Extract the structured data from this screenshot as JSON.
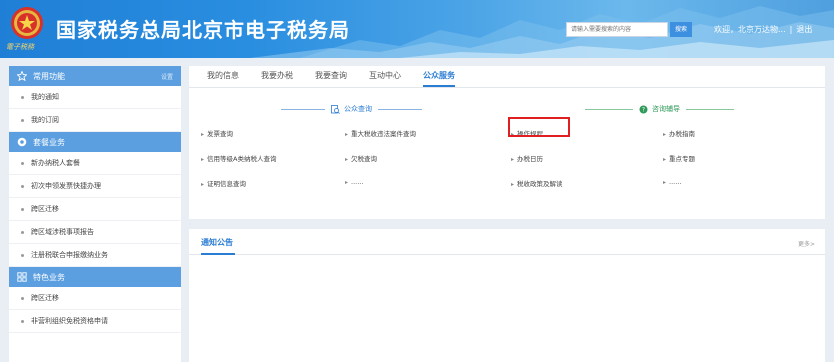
{
  "header": {
    "emblem_text": "電子税務",
    "site_title": "国家税务总局北京市电子税务局",
    "search_placeholder": "请输入需要搜索的内容",
    "search_button": "搜索",
    "welcome": "欢迎，北京万达物...",
    "logout": "退出"
  },
  "sidebar": {
    "section1": {
      "title": "常用功能",
      "extra": "设置",
      "icon": "star-icon"
    },
    "section1_items": [
      "我的通知",
      "我的订阅"
    ],
    "section2": {
      "title": "套餐业务",
      "icon": "package-icon"
    },
    "section2_items": [
      "新办纳税人套餐",
      "初次申领发票快捷办理",
      "跨区迁移",
      "跨区域涉税事项报告",
      "注册税联合申报缴纳业务"
    ],
    "section3": {
      "title": "特色业务",
      "icon": "grid-icon"
    },
    "section3_items": [
      "跨区迁移",
      "非营利组织免税资格申请"
    ]
  },
  "tabs": [
    "我的信息",
    "我要办税",
    "我要查询",
    "互动中心",
    "公众服务"
  ],
  "active_tab": "公众服务",
  "public_query": {
    "title": "公众查询",
    "items": [
      "发票查询",
      "重大税收违法案件查询",
      "信用等级A类纳税人查询",
      "欠税查询",
      "证明信息查询",
      "......"
    ]
  },
  "consult": {
    "title": "咨询辅导",
    "items": [
      "操作规程",
      "办税指南",
      "办税日历",
      "重点专题",
      "税收政策及解读",
      "......"
    ]
  },
  "notice": {
    "title": "通知公告",
    "more": "更多>"
  },
  "colors": {
    "accent": "#2b7cd3",
    "sidebar_head": "#5b9fe0",
    "highlight": "#e02020",
    "consult_green": "#2f9a5a"
  }
}
